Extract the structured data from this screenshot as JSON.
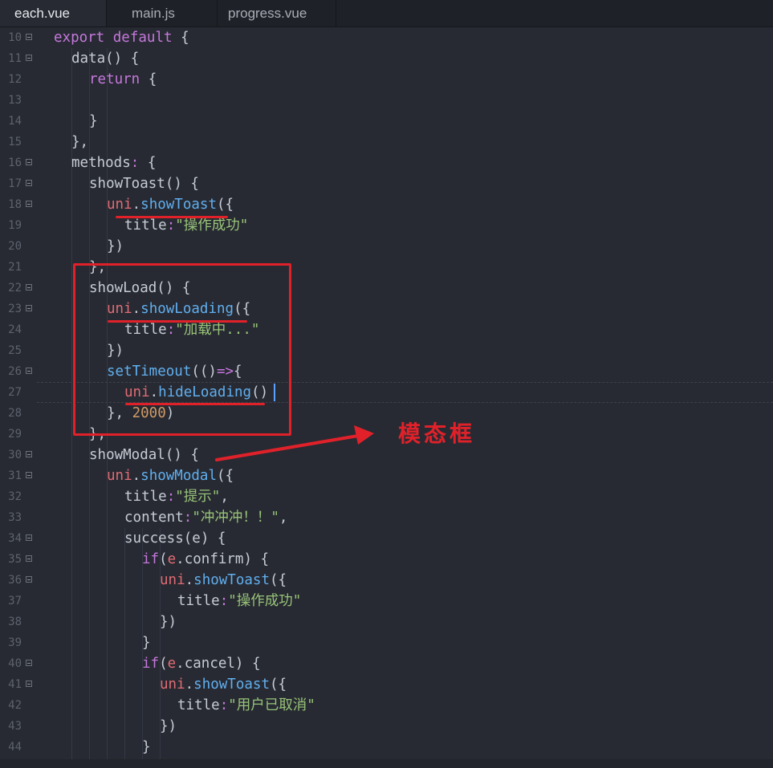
{
  "tabs": [
    {
      "label": "each.vue",
      "active": true
    },
    {
      "label": "main.js",
      "active": false
    },
    {
      "label": "progress.vue",
      "active": false
    }
  ],
  "annotation": "模态框",
  "lines": [
    {
      "n": "10",
      "fold": true,
      "indent": 0,
      "tokens": [
        [
          "kw",
          "export"
        ],
        [
          "pl",
          " "
        ],
        [
          "kw",
          "default"
        ],
        [
          "pl",
          " {"
        ]
      ]
    },
    {
      "n": "11",
      "fold": true,
      "indent": 1,
      "tokens": [
        [
          "pl",
          "data() {"
        ]
      ]
    },
    {
      "n": "12",
      "fold": false,
      "indent": 2,
      "tokens": [
        [
          "kw",
          "return"
        ],
        [
          "pl",
          " {"
        ]
      ]
    },
    {
      "n": "13",
      "fold": false,
      "indent": 2,
      "tokens": []
    },
    {
      "n": "14",
      "fold": false,
      "indent": 2,
      "tokens": [
        [
          "pl",
          "}"
        ]
      ]
    },
    {
      "n": "15",
      "fold": false,
      "indent": 1,
      "tokens": [
        [
          "pl",
          "},"
        ]
      ]
    },
    {
      "n": "16",
      "fold": true,
      "indent": 1,
      "tokens": [
        [
          "pl",
          "methods"
        ],
        [
          "kw",
          ":"
        ],
        [
          "pl",
          " {"
        ]
      ]
    },
    {
      "n": "17",
      "fold": true,
      "indent": 2,
      "tokens": [
        [
          "pl",
          "showToast() {"
        ]
      ]
    },
    {
      "n": "18",
      "fold": true,
      "indent": 3,
      "tokens": [
        [
          "obj",
          "uni"
        ],
        [
          "pl",
          "."
        ],
        [
          "fn",
          "showToast"
        ],
        [
          "pl",
          "({"
        ]
      ]
    },
    {
      "n": "19",
      "fold": false,
      "indent": 4,
      "tokens": [
        [
          "pl",
          "title"
        ],
        [
          "kw",
          ":"
        ],
        [
          "str",
          "\"操作成功\""
        ]
      ]
    },
    {
      "n": "20",
      "fold": false,
      "indent": 3,
      "tokens": [
        [
          "pl",
          "})"
        ]
      ]
    },
    {
      "n": "21",
      "fold": false,
      "indent": 2,
      "tokens": [
        [
          "pl",
          "},"
        ]
      ]
    },
    {
      "n": "22",
      "fold": true,
      "indent": 2,
      "tokens": [
        [
          "pl",
          "showLoad() {"
        ]
      ]
    },
    {
      "n": "23",
      "fold": true,
      "indent": 3,
      "tokens": [
        [
          "obj",
          "uni"
        ],
        [
          "pl",
          "."
        ],
        [
          "fn",
          "showLoading"
        ],
        [
          "pl",
          "({"
        ]
      ]
    },
    {
      "n": "24",
      "fold": false,
      "indent": 4,
      "tokens": [
        [
          "pl",
          "title"
        ],
        [
          "kw",
          ":"
        ],
        [
          "str",
          "\"加载中...\""
        ]
      ]
    },
    {
      "n": "25",
      "fold": false,
      "indent": 3,
      "tokens": [
        [
          "pl",
          "})"
        ]
      ]
    },
    {
      "n": "26",
      "fold": true,
      "indent": 3,
      "tokens": [
        [
          "fn",
          "setTimeout"
        ],
        [
          "pl",
          "(()"
        ],
        [
          "kw",
          "=>"
        ],
        [
          "pl",
          "{"
        ]
      ]
    },
    {
      "n": "27",
      "fold": false,
      "indent": 4,
      "tokens": [
        [
          "obj",
          "uni"
        ],
        [
          "pl",
          "."
        ],
        [
          "fn",
          "hideLoading"
        ],
        [
          "pl",
          "()"
        ]
      ]
    },
    {
      "n": "28",
      "fold": false,
      "indent": 3,
      "tokens": [
        [
          "pl",
          "}, "
        ],
        [
          "num",
          "2000"
        ],
        [
          "pl",
          ")"
        ]
      ]
    },
    {
      "n": "29",
      "fold": false,
      "indent": 2,
      "tokens": [
        [
          "pl",
          "},"
        ]
      ]
    },
    {
      "n": "30",
      "fold": true,
      "indent": 2,
      "tokens": [
        [
          "pl",
          "showModal() {"
        ]
      ]
    },
    {
      "n": "31",
      "fold": true,
      "indent": 3,
      "tokens": [
        [
          "obj",
          "uni"
        ],
        [
          "pl",
          "."
        ],
        [
          "fn",
          "showModal"
        ],
        [
          "pl",
          "({"
        ]
      ]
    },
    {
      "n": "32",
      "fold": false,
      "indent": 4,
      "tokens": [
        [
          "pl",
          "title"
        ],
        [
          "kw",
          ":"
        ],
        [
          "str",
          "\"提示\""
        ],
        [
          "pl",
          ","
        ]
      ]
    },
    {
      "n": "33",
      "fold": false,
      "indent": 4,
      "tokens": [
        [
          "pl",
          "content"
        ],
        [
          "kw",
          ":"
        ],
        [
          "str",
          "\"冲冲冲！！\""
        ],
        [
          "pl",
          ","
        ]
      ]
    },
    {
      "n": "34",
      "fold": true,
      "indent": 4,
      "tokens": [
        [
          "pl",
          "success(e) {"
        ]
      ]
    },
    {
      "n": "35",
      "fold": true,
      "indent": 5,
      "tokens": [
        [
          "kw",
          "if"
        ],
        [
          "pl",
          "("
        ],
        [
          "obj",
          "e"
        ],
        [
          "pl",
          ".confirm) {"
        ]
      ]
    },
    {
      "n": "36",
      "fold": true,
      "indent": 6,
      "tokens": [
        [
          "obj",
          "uni"
        ],
        [
          "pl",
          "."
        ],
        [
          "fn",
          "showToast"
        ],
        [
          "pl",
          "({"
        ]
      ]
    },
    {
      "n": "37",
      "fold": false,
      "indent": 7,
      "tokens": [
        [
          "pl",
          "title"
        ],
        [
          "kw",
          ":"
        ],
        [
          "str",
          "\"操作成功\""
        ]
      ]
    },
    {
      "n": "38",
      "fold": false,
      "indent": 6,
      "tokens": [
        [
          "pl",
          "})"
        ]
      ]
    },
    {
      "n": "39",
      "fold": false,
      "indent": 5,
      "tokens": [
        [
          "pl",
          "}"
        ]
      ]
    },
    {
      "n": "40",
      "fold": true,
      "indent": 5,
      "tokens": [
        [
          "kw",
          "if"
        ],
        [
          "pl",
          "("
        ],
        [
          "obj",
          "e"
        ],
        [
          "pl",
          ".cancel) {"
        ]
      ]
    },
    {
      "n": "41",
      "fold": true,
      "indent": 6,
      "tokens": [
        [
          "obj",
          "uni"
        ],
        [
          "pl",
          "."
        ],
        [
          "fn",
          "showToast"
        ],
        [
          "pl",
          "({"
        ]
      ]
    },
    {
      "n": "42",
      "fold": false,
      "indent": 7,
      "tokens": [
        [
          "pl",
          "title"
        ],
        [
          "kw",
          ":"
        ],
        [
          "str",
          "\"用户已取消\""
        ]
      ]
    },
    {
      "n": "43",
      "fold": false,
      "indent": 6,
      "tokens": [
        [
          "pl",
          "})"
        ]
      ]
    },
    {
      "n": "44",
      "fold": false,
      "indent": 5,
      "tokens": [
        [
          "pl",
          "}"
        ]
      ]
    }
  ]
}
